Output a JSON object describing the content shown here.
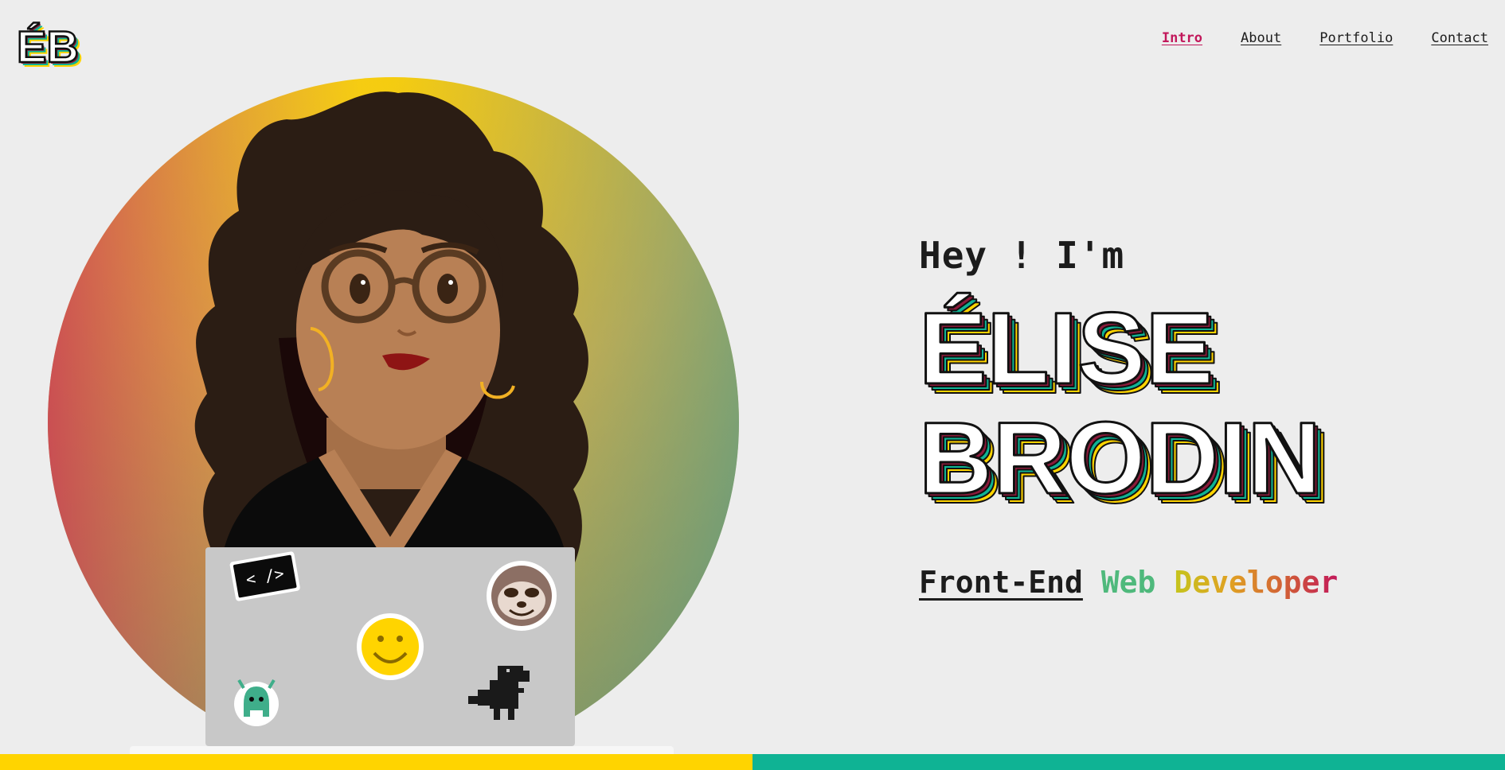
{
  "logo": {
    "text": "ÉB"
  },
  "nav": {
    "items": [
      {
        "label": "Intro",
        "active": true
      },
      {
        "label": "About",
        "active": false
      },
      {
        "label": "Portfolio",
        "active": false
      },
      {
        "label": "Contact",
        "active": false
      }
    ]
  },
  "hero": {
    "greeting": "Hey ! I'm",
    "first_name": "ÉLISE",
    "last_name": "BRODIN",
    "tagline": {
      "part1": "Front-End",
      "part2": "Web",
      "part3": "Developer"
    },
    "laptop_sticker_code": "< />"
  },
  "colors": {
    "accent": "#c2185b",
    "yellow": "#ffd400",
    "teal": "#0fb394",
    "green": "#4fb97c",
    "background": "#ededed"
  },
  "icons": [
    "code-sticker-icon",
    "smiley-icon",
    "sloth-icon",
    "monster-icon",
    "dino-icon"
  ],
  "footer": {
    "bar_colors": [
      "#ffd400",
      "#0fb394"
    ]
  }
}
